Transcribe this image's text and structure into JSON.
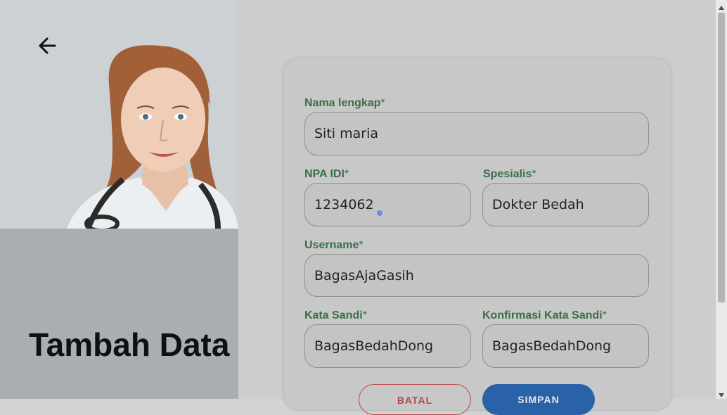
{
  "page": {
    "title": "Tambah Data"
  },
  "form": {
    "nama_lengkap": {
      "label": "Nama lengkap",
      "required_mark": "*",
      "value": "Siti maria"
    },
    "npa_idi": {
      "label": "NPA IDI",
      "required_mark": "*",
      "value": "1234062"
    },
    "spesialis": {
      "label": "Spesialis",
      "required_mark": "*",
      "value": "Dokter Bedah"
    },
    "username": {
      "label": "Username",
      "required_mark": "*",
      "value": "BagasAjaGasih"
    },
    "kata_sandi": {
      "label": "Kata Sandi",
      "required_mark": "*",
      "value": "BagasBedahDong"
    },
    "konfirmasi_kata_sandi": {
      "label": "Konfirmasi Kata Sandi",
      "required_mark": "*",
      "value": "BagasBedahDong"
    }
  },
  "buttons": {
    "cancel_label": "BATAL",
    "save_label": "SIMPAN"
  },
  "icons": {
    "back": "arrow-left-icon",
    "scroll_up": "triangle-up-icon",
    "scroll_down": "triangle-down-icon"
  },
  "colors": {
    "label_green": "#3b6e4a",
    "save_blue": "#2a62a8",
    "cancel_red": "#b8454a"
  }
}
